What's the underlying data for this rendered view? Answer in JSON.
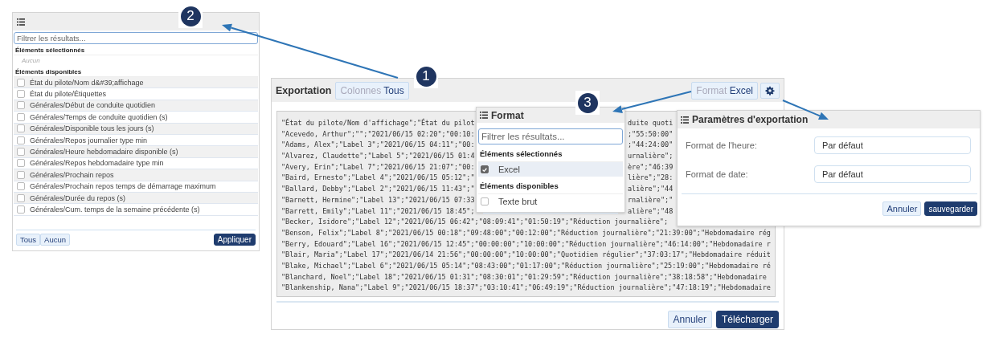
{
  "columns_panel": {
    "filter": {
      "placeholder": "Filtrer les résultats..."
    },
    "selected_heading": "Éléments sélectionnés",
    "selected_empty": "Aucun",
    "available_heading": "Éléments disponibles",
    "items": [
      {
        "label": "État du pilote/Nom d&#39;affichage",
        "checked": false
      },
      {
        "label": "État du pilote/Étiquettes",
        "checked": false
      },
      {
        "label": "Générales/Début de conduite quotidien",
        "checked": false
      },
      {
        "label": "Générales/Temps de conduite quotidien (s)",
        "checked": false
      },
      {
        "label": "Générales/Disponible tous les jours (s)",
        "checked": false
      },
      {
        "label": "Générales/Repos journalier type min",
        "checked": false
      },
      {
        "label": "Générales/Heure hebdomadaire disponible (s)",
        "checked": false
      },
      {
        "label": "Générales/Repos hebdomadaire type min",
        "checked": false
      },
      {
        "label": "Générales/Prochain repos",
        "checked": false
      },
      {
        "label": "Générales/Prochain repos temps de démarrage maximum",
        "checked": false
      },
      {
        "label": "Générales/Durée du repos (s)",
        "checked": false
      },
      {
        "label": "Générales/Cum. temps de la semaine précédente (s)",
        "checked": false
      }
    ],
    "footer": {
      "select_all": "Tous",
      "select_none": "Aucun",
      "apply": "Appliquer"
    }
  },
  "export_panel": {
    "title": "Exportation",
    "columns_button": {
      "label": "Colonnes",
      "value": "Tous"
    },
    "format_button": {
      "label": "Format",
      "value": "Excel"
    },
    "preview_rows": [
      {
        "segments": [
          "\"État du pilote/Nom d'affichage\";\"État du pilot",
          "duite quoti"
        ]
      },
      {
        "segments": [
          "\"Acevedo, Arthur\";\"\";\"2021/06/15 02:20\";\"00:10:",
          ";\"55:50:00\""
        ]
      },
      {
        "segments": [
          "\"Adams, Alex\";\"Label 3\";\"2021/06/15 04:11\";\"00:",
          ";\"44:24:00\""
        ]
      },
      {
        "segments": [
          "\"Alvarez, Claudette\";\"Label 5\";\"2021/06/15 01:4",
          "urnalière\";"
        ]
      },
      {
        "segments": [
          "\"Avery, Erin\";\"Label 7\";\"2021/06/15 21:07\";\"00:",
          "ère\";\"46:39"
        ]
      },
      {
        "segments": [
          "\"Baird, Ernesto\";\"Label 4\";\"2021/06/15 05:12\";\"",
          "lière\";\"28:"
        ]
      },
      {
        "segments": [
          "\"Ballard, Debby\";\"Label 2\";\"2021/06/15 11:43\";\"",
          "alière\";\"44"
        ]
      },
      {
        "segments": [
          "\"Barnett, Hermine\";\"Label 13\";\"2021/06/15 07:33",
          "rnalière\";\""
        ]
      },
      {
        "segments": [
          "\"Barrett, Emily\";\"Label 11\";\"2021/06/15 18:45\";",
          "alière\";\"48"
        ]
      },
      {
        "segments": [
          "\"Becker, Isidore\";\"Label 12\";\"2021/06/15 06:42\";\"08:09:41\";\"01:50:19\";\"Réduction journalière\";"
        ]
      },
      {
        "segments": [
          "\"Benson, Felix\";\"Label 8\";\"2021/06/15 00:18\";\"09:48:00\";\"00:12:00\";\"Réduction journalière\";\"21:39:00\";\"Hebdomadaire rég"
        ]
      },
      {
        "segments": [
          "\"Berry, Edouard\";\"Label 16\";\"2021/06/15 12:45\";\"00:00:00\";\"10:00:00\";\"Réduction journalière\";\"46:14:00\";\"Hebdomadaire r"
        ]
      },
      {
        "segments": [
          "\"Blair, Maria\";\"Label 17\";\"2021/06/14 21:56\";\"00:00:00\";\"10:00:00\";\"Quotidien régulier\";\"37:03:17\";\"Hebdomadaire réduit"
        ]
      },
      {
        "segments": [
          "\"Blake, Michael\";\"Label 6\";\"2021/06/15 05:14\";\"08:43:00\";\"01:17:00\";\"Réduction journalière\";\"25:19:00\";\"Hebdomadaire ré"
        ]
      },
      {
        "segments": [
          "\"Blanchard, Noel\";\"Label 18\";\"2021/06/15 01:31\";\"08:30:01\";\"01:29:59\";\"Réduction journalière\";\"38:18:58\";\"Hebdomadaire"
        ]
      },
      {
        "segments": [
          "\"Blankenship, Nana\";\"Label 9\";\"2021/06/15 18:37\";\"03:10:41\";\"06:49:19\";\"Réduction journalière\";\"47:18:19\";\"Hebdomadaire"
        ]
      }
    ],
    "buttons": {
      "cancel": "Annuler",
      "download": "Télécharger"
    }
  },
  "format_popup": {
    "title": "Format",
    "filter": {
      "placeholder": "Filtrer les résultats..."
    },
    "selected_heading": "Éléments sélectionnés",
    "selected_items": [
      {
        "label": "Excel",
        "checked": true
      }
    ],
    "available_heading": "Éléments disponibles",
    "available_items": [
      {
        "label": "Texte brut",
        "checked": false
      }
    ]
  },
  "settings_popup": {
    "title": "Paramètres d'exportation",
    "fields": [
      {
        "label": "Format de l'heure:",
        "value": "Par défaut"
      },
      {
        "label": "Format de date:",
        "value": "Par défaut"
      }
    ],
    "buttons": {
      "cancel": "Annuler",
      "save": "sauvegarder"
    }
  },
  "callouts": [
    {
      "number": "1"
    },
    {
      "number": "2"
    },
    {
      "number": "3"
    }
  ]
}
